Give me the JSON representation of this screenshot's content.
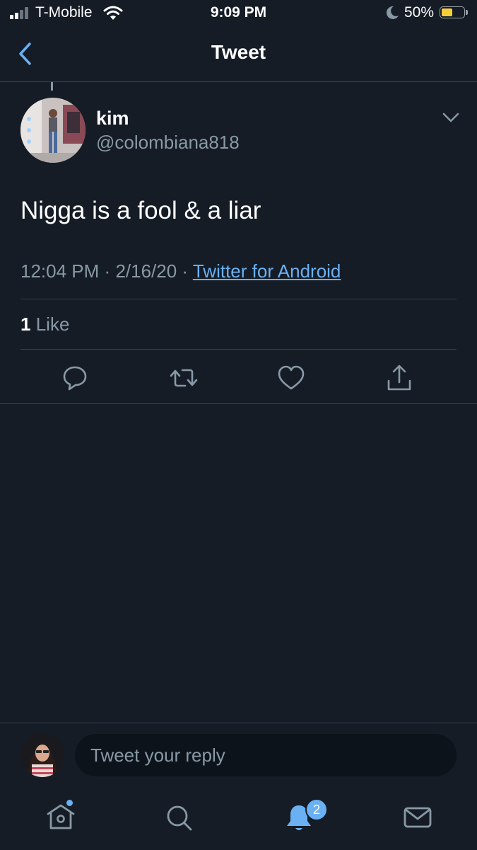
{
  "status_bar": {
    "carrier": "T-Mobile",
    "time": "9:09 PM",
    "battery_percent": "50%",
    "battery_level": 0.5
  },
  "header": {
    "title": "Tweet",
    "back_icon": "chevron-left-icon"
  },
  "tweet": {
    "display_name": "kim",
    "handle": "@colombiana818",
    "text": "Nigga is a fool & a liar",
    "time": "12:04 PM",
    "date": "2/16/20",
    "separator": "·",
    "source": "Twitter for Android",
    "like_count": "1",
    "like_label": "Like",
    "actions": [
      "reply-icon",
      "retweet-icon",
      "like-icon",
      "share-icon"
    ]
  },
  "reply_bar": {
    "placeholder": "Tweet your reply"
  },
  "tab_bar": {
    "tabs": [
      "home-icon",
      "search-icon",
      "notifications-icon",
      "messages-icon"
    ],
    "notification_count": "2"
  },
  "colors": {
    "background": "#151c26",
    "accent": "#6ab0f3",
    "secondary_text": "#8899a6",
    "divider": "#38444d"
  }
}
